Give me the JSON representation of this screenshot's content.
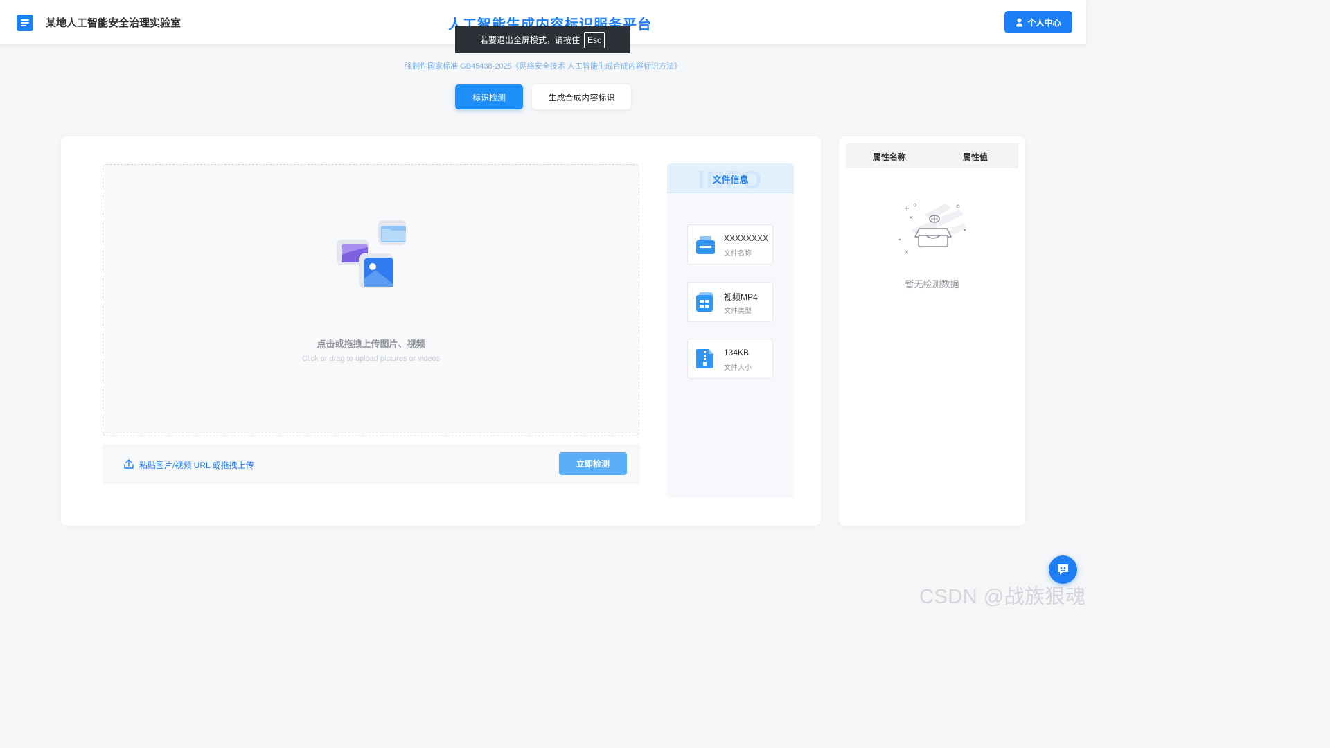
{
  "header": {
    "lab_name": "某地人工智能安全治理实验室",
    "title": "人工智能生成内容标识服务平台",
    "profile_button": "个人中心"
  },
  "fullscreen_toast": {
    "message": "若要退出全屏模式，请按住",
    "key": "Esc"
  },
  "subtitle": "强制性国家标准 GB45438-2025《网络安全技术 人工智能生成合成内容标识方法》",
  "tabs": [
    {
      "label": "标识检测",
      "active": true
    },
    {
      "label": "生成合成内容标识",
      "active": false
    }
  ],
  "upload": {
    "title": "点击或拖拽上传图片、视频",
    "hint": "Click or drag to upload pictures or videos",
    "url_label": "粘贴图片/视频 URL 或拖拽上传",
    "detect_button": "立即检测"
  },
  "file_info": {
    "watermark": "INFO",
    "title": "文件信息",
    "items": [
      {
        "value": "XXXXXXXX",
        "label": "文件名称",
        "icon": "file-box-icon"
      },
      {
        "value": "视频MP4",
        "label": "文件类型",
        "icon": "file-type-icon"
      },
      {
        "value": "134KB",
        "label": "文件大小",
        "icon": "file-zip-icon"
      }
    ]
  },
  "attributes": {
    "col_name": "属性名称",
    "col_value": "属性值",
    "empty_text": "暂无检测数据"
  },
  "watermark": "CSDN @战族狠魂",
  "colors": {
    "primary": "#1e7ef5",
    "primary_light": "#5aaef8",
    "background": "#f5f6f8"
  }
}
